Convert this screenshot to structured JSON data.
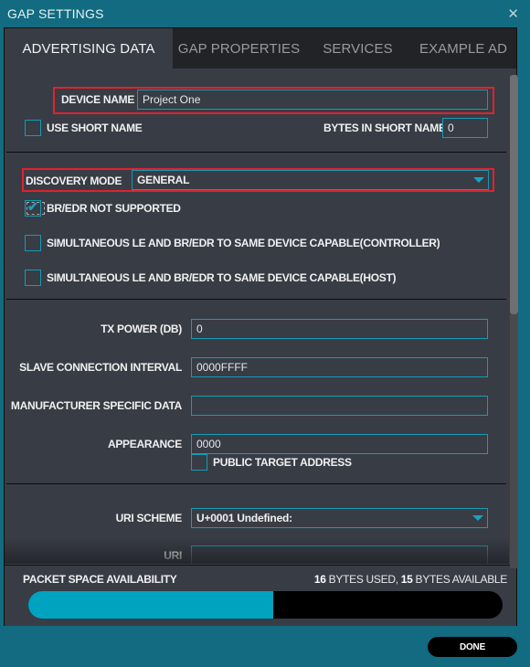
{
  "window": {
    "title": "GAP SETTINGS",
    "close_icon": "close-icon"
  },
  "tabs": [
    {
      "label": "ADVERTISING DATA",
      "active": true
    },
    {
      "label": "GAP PROPERTIES",
      "active": false
    },
    {
      "label": "SERVICES",
      "active": false
    },
    {
      "label": "EXAMPLE AD",
      "active": false
    }
  ],
  "advertising": {
    "device_name": {
      "label": "DEVICE NAME",
      "value": "Project One"
    },
    "use_short_name": {
      "label": "USE SHORT NAME",
      "checked": false
    },
    "bytes_in_short_name": {
      "label": "BYTES IN SHORT NAME",
      "value": "0"
    },
    "discovery_mode": {
      "label": "DISCOVERY MODE",
      "value": "GENERAL"
    },
    "br_edr_not_supported": {
      "label": "BR/EDR NOT SUPPORTED",
      "checked": true
    },
    "simultaneous_controller": {
      "label": "SIMULTANEOUS LE AND BR/EDR TO SAME DEVICE CAPABLE(CONTROLLER)",
      "checked": false
    },
    "simultaneous_host": {
      "label": "SIMULTANEOUS LE AND BR/EDR TO SAME DEVICE CAPABLE(HOST)",
      "checked": false
    },
    "tx_power": {
      "label": "TX POWER (DB)",
      "value": "0"
    },
    "slave_connection_interval": {
      "label": "SLAVE CONNECTION INTERVAL",
      "value": "0000FFFF"
    },
    "manufacturer_specific_data": {
      "label": "MANUFACTURER SPECIFIC DATA",
      "value": ""
    },
    "appearance": {
      "label": "APPEARANCE",
      "value": "0000"
    },
    "public_target_address": {
      "label": "PUBLIC TARGET ADDRESS",
      "checked": false
    },
    "uri_scheme": {
      "label": "URI SCHEME",
      "value": "U+0001 Undefined:"
    },
    "uri": {
      "label": "URI",
      "value": ""
    }
  },
  "packet": {
    "label": "PACKET SPACE AVAILABILITY",
    "used": "16",
    "used_suffix": " BYTES USED, ",
    "available": "15",
    "available_suffix": " BYTES AVAILABLE",
    "fill_fraction": 0.516
  },
  "footer": {
    "done_label": "DONE"
  },
  "colors": {
    "accent": "#149bb4",
    "progress_fill": "#00a3bf",
    "highlight": "#e0222e",
    "background": "#126b80",
    "panel": "#383c45"
  }
}
